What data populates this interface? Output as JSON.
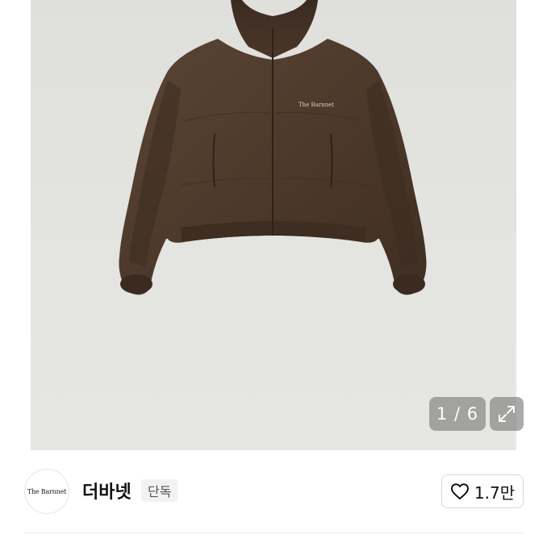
{
  "gallery": {
    "counter_text": "1 / 6",
    "jacket_logo_text": "The Barnnet",
    "expand_icon": "expand-icon"
  },
  "shop": {
    "logo_text": "The Barnnet",
    "name": "더바넷",
    "badge": "단독",
    "like_icon": "heart-outline-icon",
    "like_count": "1.7만"
  },
  "colors": {
    "jacket": "#4e3a2c",
    "background": "#e2e2df",
    "overlay": "#787878"
  }
}
